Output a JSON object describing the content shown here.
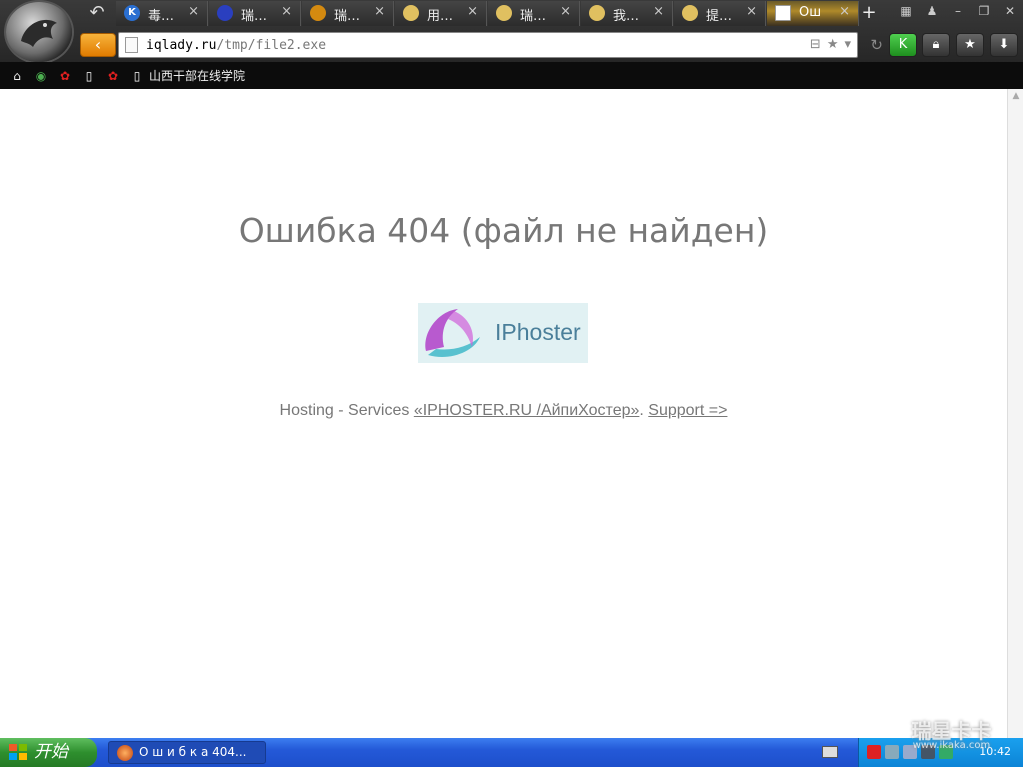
{
  "browser": {
    "back_tab_icon": "back-arrow-icon",
    "tabs": [
      {
        "label": "毒…",
        "icon": "K",
        "icon_color": "#2a6fd1",
        "close": "×"
      },
      {
        "label": "瑞…",
        "icon": "paw",
        "icon_color": "#2a3fbf",
        "close": "×"
      },
      {
        "label": "瑞…",
        "icon": "tiger",
        "icon_color": "#d48a10",
        "close": "×"
      },
      {
        "label": "用…",
        "icon": "smiley",
        "icon_color": "#e0c060",
        "close": "×"
      },
      {
        "label": "瑞…",
        "icon": "smiley",
        "icon_color": "#e0c060",
        "close": "×"
      },
      {
        "label": "我…",
        "icon": "smiley",
        "icon_color": "#e0c060",
        "close": "×"
      },
      {
        "label": "提…",
        "icon": "smiley",
        "icon_color": "#e0c060",
        "close": "×"
      },
      {
        "label": "Ош",
        "icon": "page",
        "icon_color": "#ffffff",
        "close": "×",
        "active": true
      }
    ],
    "new_tab": "+",
    "url_host": "iqlady.ru",
    "url_path": "/tmp/file2.exe",
    "bookmarks": [
      {
        "label": "",
        "icon": "home-icon"
      },
      {
        "label": "",
        "icon": "chrome-icon"
      },
      {
        "label": "",
        "icon": "weibo-icon"
      },
      {
        "label": "",
        "icon": "page-icon"
      },
      {
        "label": "",
        "icon": "weibo-icon"
      },
      {
        "label": "山西干部在线学院",
        "icon": "page-icon"
      }
    ]
  },
  "page": {
    "title": "Ошибка 404 (файл не найден)",
    "logo_text": "IPhoster",
    "footer_prefix": "Hosting - Services ",
    "footer_link": "«IPHOSTER.RU /АйпиХостер»",
    "footer_sep": ". ",
    "support_link": "Support =>"
  },
  "taskbar": {
    "start_label": "开始",
    "task_label": "О ш и б к а  404...",
    "clock": "10:42"
  },
  "watermark": {
    "main": "瑞星卡卡",
    "sub": "www.ikaka.com"
  },
  "colors": {
    "title_text": "#777777",
    "accent_orange": "#e07b00",
    "taskbar_blue": "#2459d8",
    "start_green": "#2e8f2e"
  }
}
